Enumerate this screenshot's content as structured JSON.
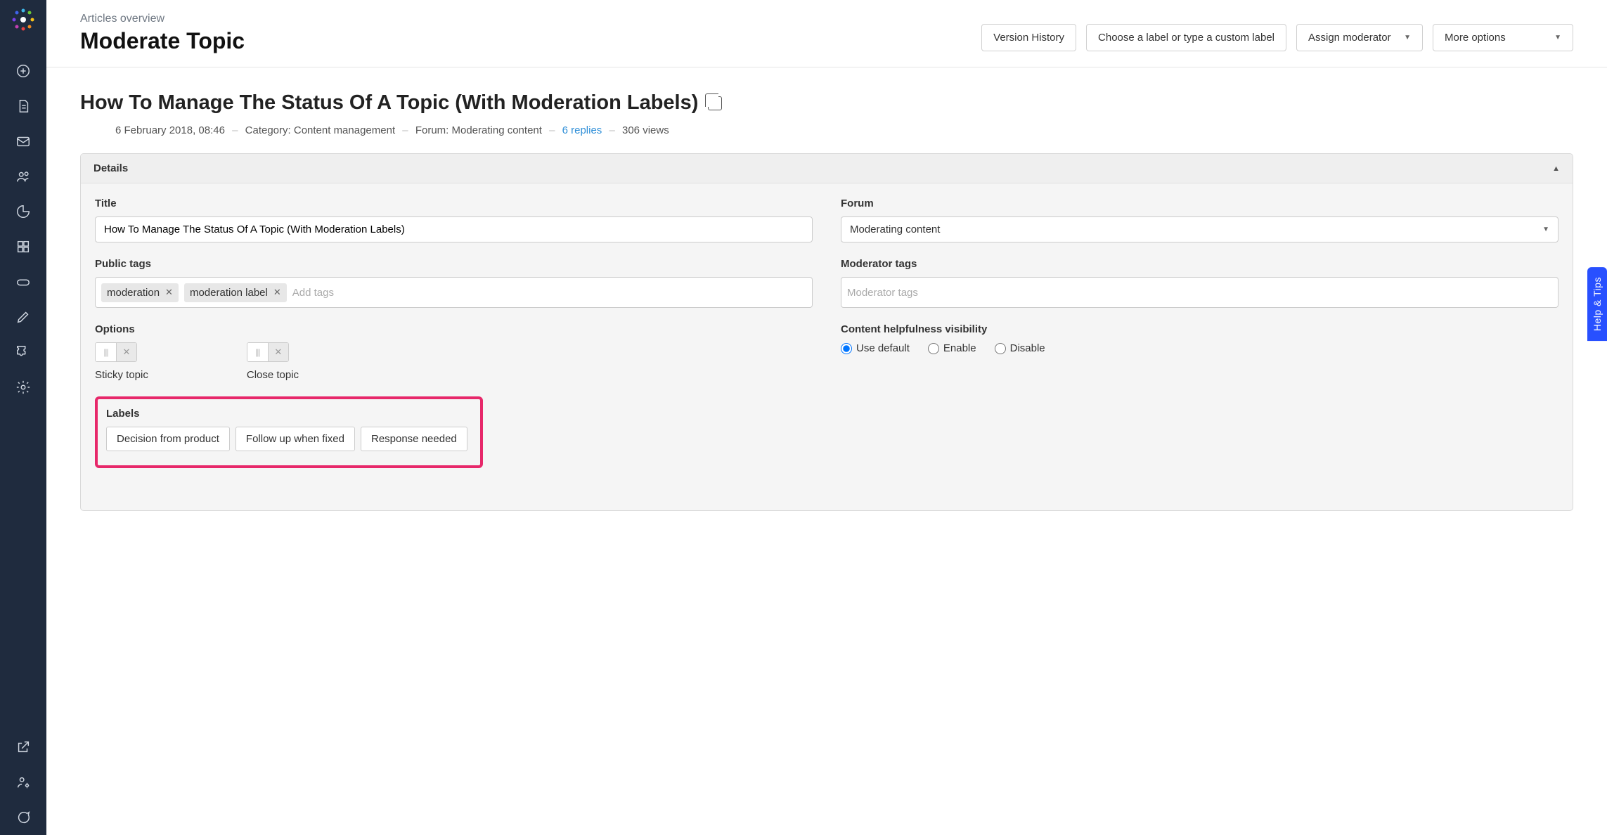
{
  "breadcrumb": "Articles overview",
  "page_title": "Moderate Topic",
  "topbar": {
    "version_history": "Version History",
    "label_chooser": "Choose a label or type a custom label",
    "assign_moderator": "Assign moderator",
    "more_options": "More options"
  },
  "topic": {
    "title": "How To Manage The Status Of A Topic (With Moderation Labels)",
    "timestamp": "6 February 2018, 08:46",
    "category_label": "Category:",
    "category": "Content management",
    "forum_label": "Forum:",
    "forum": "Moderating content",
    "replies": "6 replies",
    "views": "306 views"
  },
  "panel": {
    "header": "Details",
    "title_label": "Title",
    "title_value": "How To Manage The Status Of A Topic (With Moderation Labels)",
    "forum_label": "Forum",
    "forum_value": "Moderating content",
    "public_tags_label": "Public tags",
    "public_tags": [
      "moderation",
      "moderation label"
    ],
    "add_tags_placeholder": "Add tags",
    "moderator_tags_label": "Moderator tags",
    "moderator_tags_placeholder": "Moderator tags",
    "options_label": "Options",
    "sticky_label": "Sticky topic",
    "close_label": "Close topic",
    "helpfulness_label": "Content helpfulness visibility",
    "helpfulness_options": [
      "Use default",
      "Enable",
      "Disable"
    ],
    "labels_label": "Labels",
    "labels": [
      "Decision from product",
      "Follow up when fixed",
      "Response needed"
    ]
  },
  "help_tab": "Help & Tips"
}
